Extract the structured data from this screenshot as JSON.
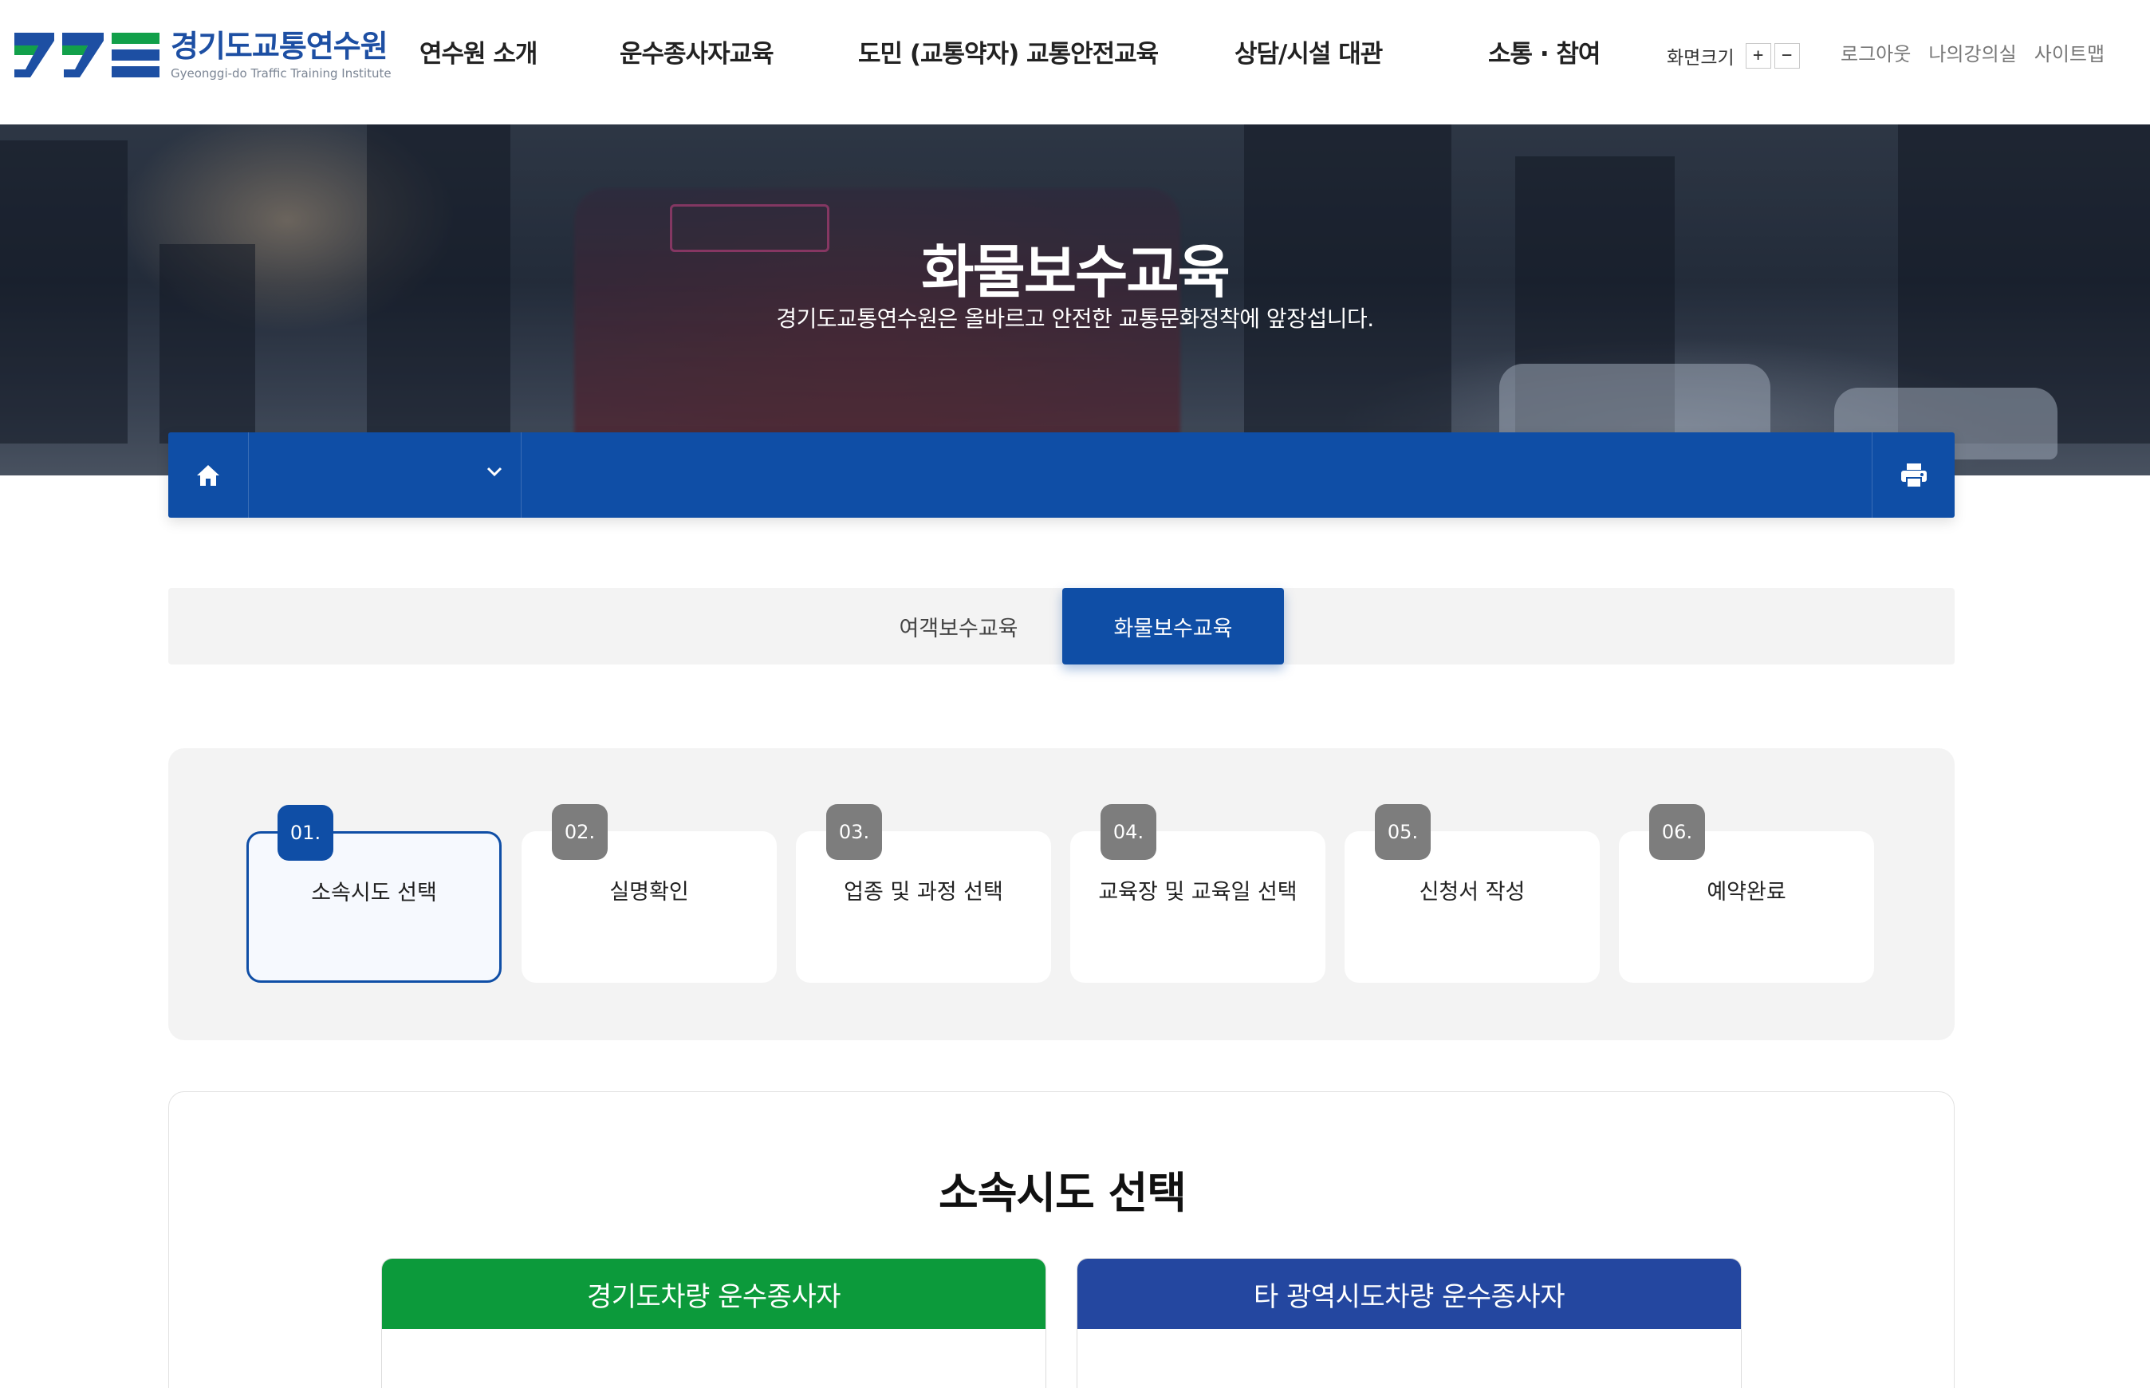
{
  "header": {
    "logo_ko": "경기도교통연수원",
    "logo_en": "Gyeonggi-do Traffic Training Institute",
    "nav": [
      {
        "label": "연수원 소개"
      },
      {
        "label": "운수종사자교육"
      },
      {
        "label": "도민 (교통약자) 교통안전교육"
      },
      {
        "label": "상담/시설 대관"
      },
      {
        "label": "소통 · 참여"
      }
    ],
    "zoom_label": "화면크기",
    "zoom_in": "+",
    "zoom_out": "−",
    "util_links": [
      "로그아웃",
      "나의강의실",
      "사이트맵"
    ]
  },
  "visual": {
    "title": "화물보수교육",
    "description": "경기도교통연수원은 올바르고 안전한 교통문화정착에 앞장섭니다."
  },
  "location": {
    "home_icon": "home-icon",
    "select_value": "",
    "print_icon": "print-icon"
  },
  "tabs": [
    {
      "label": "여객보수교육",
      "active": false
    },
    {
      "label": "화물보수교육",
      "active": true
    }
  ],
  "steps": [
    {
      "num": "01.",
      "label": "소속시도 선택",
      "active": true
    },
    {
      "num": "02.",
      "label": "실명확인",
      "active": false
    },
    {
      "num": "03.",
      "label": "업종 및 과정 선택",
      "active": false
    },
    {
      "num": "04.",
      "label": "교육장 및 교육일 선택",
      "active": false
    },
    {
      "num": "05.",
      "label": "신청서 작성",
      "active": false
    },
    {
      "num": "06.",
      "label": "예약완료",
      "active": false
    }
  ],
  "section": {
    "title": "소속시도 선택",
    "options": [
      {
        "label": "경기도차량 운수종사자",
        "color": "#0c9a3b"
      },
      {
        "label": "타 광역시도차량 운수종사자",
        "color": "#2447a0"
      }
    ]
  },
  "colors": {
    "primary": "#0f4ea6",
    "green": "#0c9a3b",
    "step_inactive": "#7d7d7d"
  }
}
